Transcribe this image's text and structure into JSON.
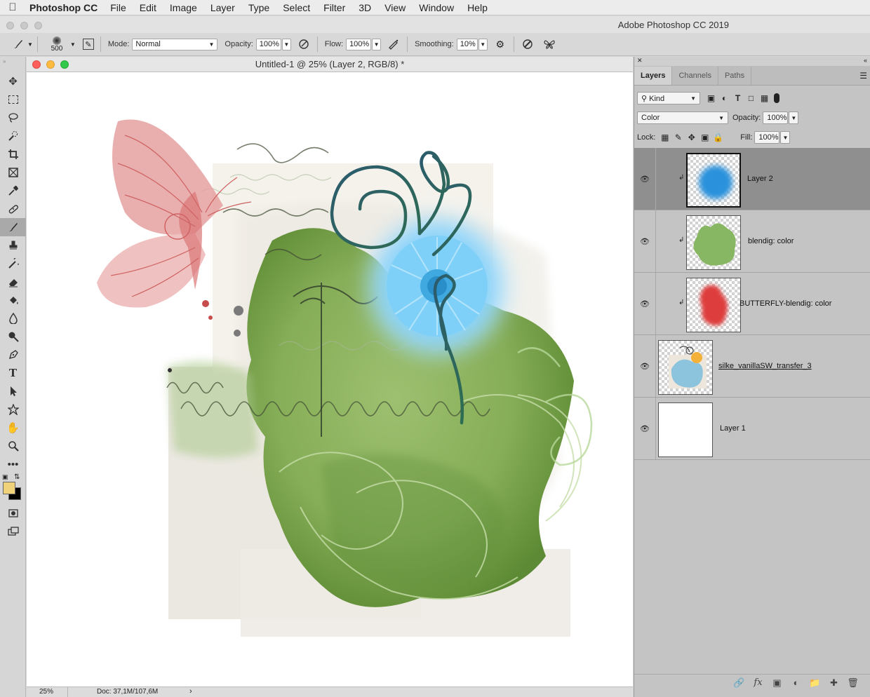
{
  "menubar": {
    "apple": "",
    "app": "Photoshop CC",
    "items": [
      "File",
      "Edit",
      "Image",
      "Layer",
      "Type",
      "Select",
      "Filter",
      "3D",
      "View",
      "Window",
      "Help"
    ]
  },
  "app_title": "Adobe Photoshop CC 2019",
  "options": {
    "brush_size": "500",
    "mode_label": "Mode:",
    "mode_value": "Normal",
    "opacity_label": "Opacity:",
    "opacity_value": "100%",
    "flow_label": "Flow:",
    "flow_value": "100%",
    "smoothing_label": "Smoothing:",
    "smoothing_value": "10%"
  },
  "colors": {
    "foreground": "#f0d27a",
    "background": "#000000"
  },
  "document": {
    "title": "Untitled-1 @ 25% (Layer 2, RGB/8) *",
    "zoom": "25%",
    "doc_info": "Doc: 37,1M/107,6M"
  },
  "panel": {
    "tabs": [
      "Layers",
      "Channels",
      "Paths"
    ],
    "kind_label": "Kind",
    "blend_value": "Color",
    "opacity_label": "Opacity:",
    "opacity_value": "100%",
    "lock_label": "Lock:",
    "fill_label": "Fill:",
    "fill_value": "100%",
    "layers": [
      {
        "name": "Layer 2",
        "selected": true,
        "clipped": true,
        "thumb": "blue-blob"
      },
      {
        "name": "blendig: color",
        "selected": false,
        "clipped": true,
        "thumb": "green-blob"
      },
      {
        "name": "BUTTERFLY-blendig: color",
        "selected": false,
        "clipped": true,
        "thumb": "red-blob"
      },
      {
        "name": "silke_vanillaSW_transfer_3",
        "selected": false,
        "clipped": false,
        "thumb": "collage"
      },
      {
        "name": "Layer 1",
        "selected": false,
        "clipped": false,
        "thumb": "white"
      }
    ]
  }
}
